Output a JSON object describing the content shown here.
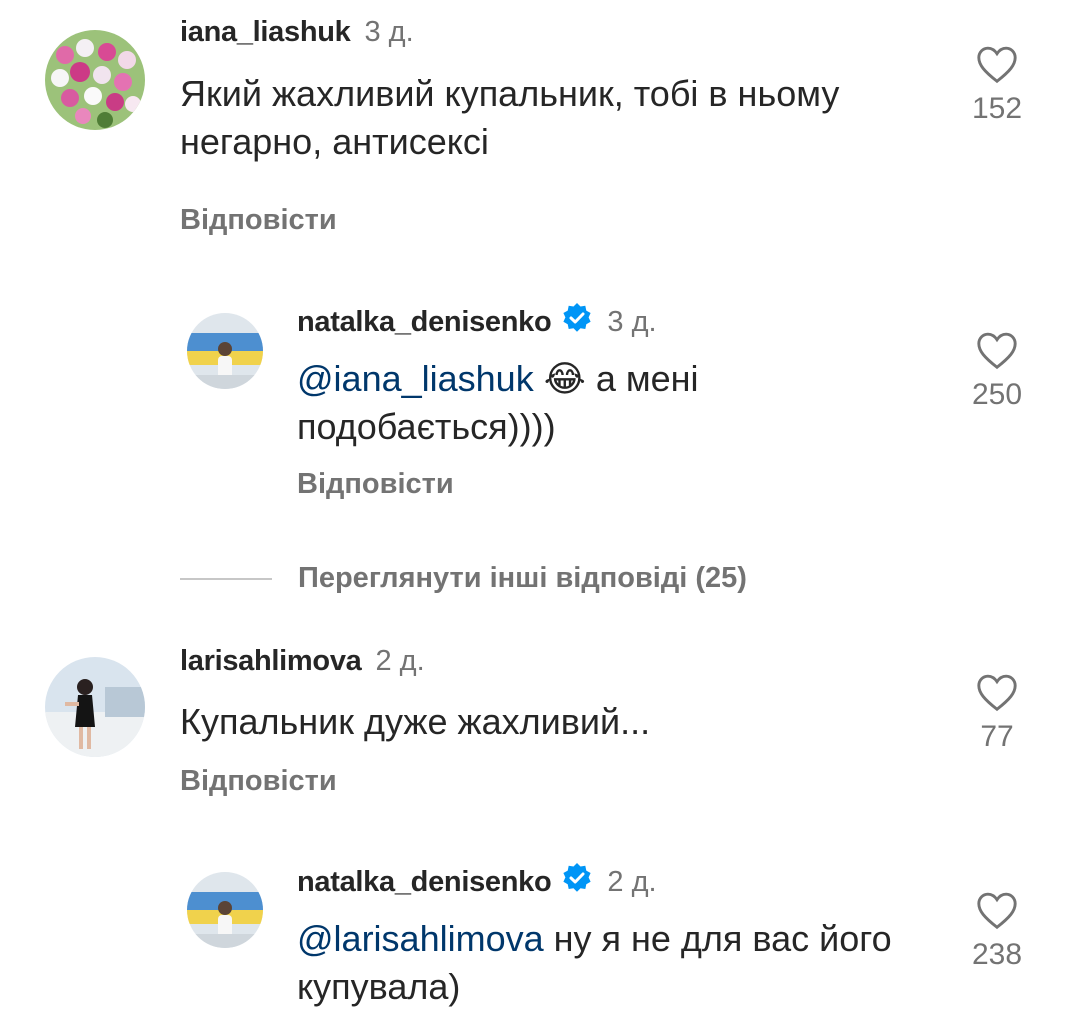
{
  "comments": [
    {
      "username": "iana_liashuk",
      "time": "3 д.",
      "text": "Який жахливий купальник, тобі в ньому негарно, антисексі",
      "reply_label": "Відповісти",
      "likes": "152"
    },
    {
      "username": "natalka_denisenko",
      "verified": true,
      "time": "3 д.",
      "mention": "@iana_liashuk",
      "emoji": "😂",
      "text": "а мені подобається))))",
      "reply_label": "Відповісти",
      "likes": "250"
    },
    {
      "username": "larisahlimova",
      "time": "2 д.",
      "text": "Купальник дуже жахливий...",
      "reply_label": "Відповісти",
      "likes": "77"
    },
    {
      "username": "natalka_denisenko",
      "verified": true,
      "time": "2 д.",
      "mention": "@larisahlimova",
      "text": "ну я не для вас його купувала)",
      "likes": "238"
    }
  ],
  "view_more_replies": "Переглянути інші відповіді (25)",
  "colors": {
    "text": "#262626",
    "secondary": "#737373",
    "mention": "#00376b",
    "verified": "#0095f6"
  },
  "icons": [
    "heart-icon",
    "verified-badge-icon"
  ]
}
